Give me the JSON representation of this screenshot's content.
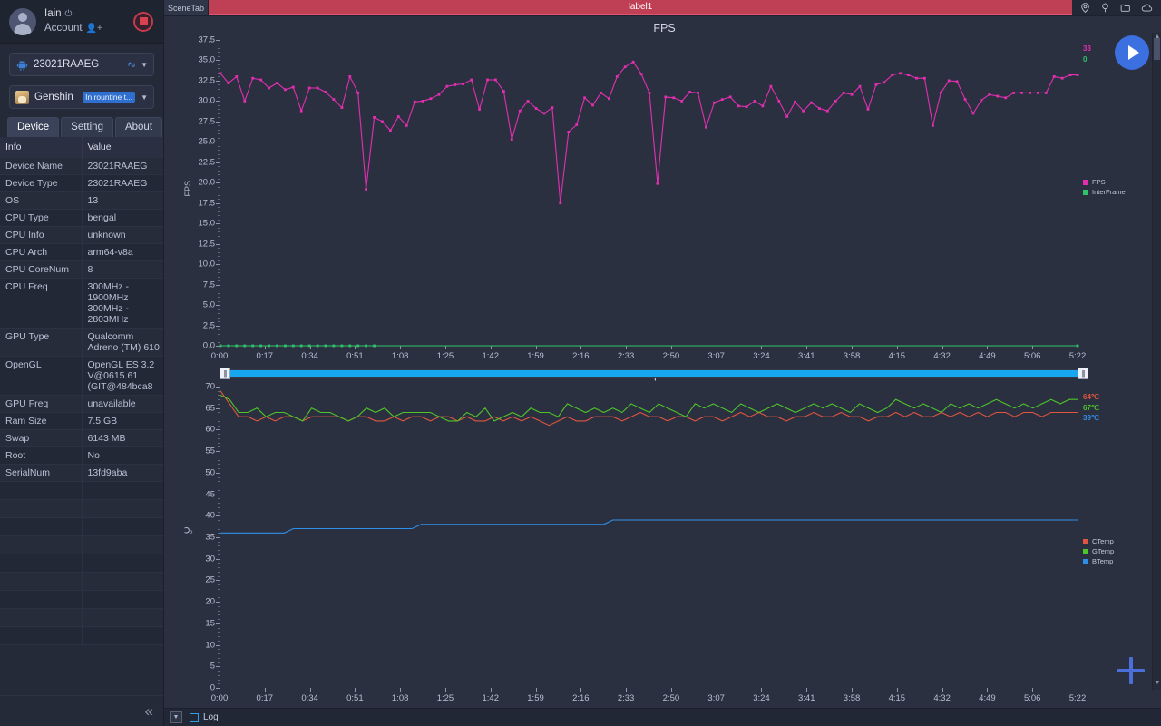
{
  "sidebar": {
    "account": {
      "name": "Iain",
      "power_icon": "power-icon",
      "label": "Account",
      "account_icon": "user-add-icon",
      "record_button": "record-button"
    },
    "device_selector": {
      "value": "23021RAAEG",
      "device_icon": "android-icon",
      "link_icon": "link-icon",
      "caret": "chevron-down-icon"
    },
    "app_selector": {
      "value": "Genshin Imp...",
      "tag": "In rountine t...",
      "app_icon": "app-thumbnail",
      "caret": "chevron-down-icon"
    },
    "tabs": [
      {
        "label": "Device",
        "active": true
      },
      {
        "label": "Setting",
        "active": false
      },
      {
        "label": "About",
        "active": false
      }
    ],
    "table": {
      "headers": [
        "Info",
        "Value"
      ],
      "rows": [
        [
          "Device Name",
          "23021RAAEG"
        ],
        [
          "Device Type",
          "23021RAAEG"
        ],
        [
          "OS",
          "13"
        ],
        [
          "CPU Type",
          "bengal"
        ],
        [
          "CPU Info",
          "unknown"
        ],
        [
          "CPU Arch",
          "arm64-v8a"
        ],
        [
          "CPU CoreNum",
          "8"
        ],
        [
          "CPU Freq",
          "300MHz - 1900MHz\n300MHz - 2803MHz"
        ],
        [
          "GPU Type",
          "Qualcomm Adreno (TM) 610"
        ],
        [
          "OpenGL",
          "OpenGL ES 3.2 V@0615.61 (GIT@484bca8"
        ],
        [
          "GPU Freq",
          "unavailable"
        ],
        [
          "Ram Size",
          "7.5 GB"
        ],
        [
          "Swap",
          "6143 MB"
        ],
        [
          "Root",
          "No"
        ],
        [
          "SerialNum",
          "13fd9aba"
        ]
      ]
    },
    "collapse_icon": "chevron-double-left-icon"
  },
  "topbar": {
    "scene_tab": "SceneTab",
    "label_tab": "label1",
    "icons": [
      "location-icon",
      "pin-icon",
      "folder-icon",
      "cloud-icon"
    ]
  },
  "buttons": {
    "play": "play-button",
    "add": "add-button"
  },
  "statusbar": {
    "dropdown_icon": "caret-down-button",
    "log_label": "Log",
    "log_checked": false
  },
  "chart_data": [
    {
      "type": "line",
      "title": "FPS",
      "xlabel": "",
      "ylabel": "FPS",
      "ylim": [
        0.0,
        37.5
      ],
      "yticks": [
        "0.0",
        "2.5",
        "5.0",
        "7.5",
        "10.0",
        "12.5",
        "15.0",
        "17.5",
        "20.0",
        "22.5",
        "25.0",
        "27.5",
        "30.0",
        "32.5",
        "35.0",
        "37.5"
      ],
      "xticks": [
        "0:00",
        "0:17",
        "0:34",
        "0:51",
        "1:08",
        "1:25",
        "1:42",
        "1:59",
        "2:16",
        "2:33",
        "2:50",
        "3:07",
        "3:24",
        "3:41",
        "3:58",
        "4:15",
        "4:32",
        "4:49",
        "5:06",
        "5:22"
      ],
      "grid": false,
      "legend_position": "right",
      "legend": [
        {
          "name": "FPS",
          "color": "#e12fb0"
        },
        {
          "name": "InterFrame",
          "color": "#2fc46a"
        }
      ],
      "current_values": [
        {
          "name": "FPS",
          "value": "33",
          "color": "#e12fb0"
        },
        {
          "name": "InterFrame",
          "value": "0",
          "color": "#2fc46a"
        }
      ],
      "series": [
        {
          "name": "FPS",
          "color": "#e12fb0",
          "values": [
            33.4,
            32.2,
            33.0,
            30.0,
            32.8,
            32.6,
            31.6,
            32.2,
            31.4,
            31.7,
            28.8,
            31.6,
            31.6,
            31.1,
            30.2,
            29.2,
            33.0,
            31.0,
            19.2,
            28.0,
            27.5,
            26.4,
            28.1,
            27.0,
            29.9,
            30.0,
            30.3,
            30.8,
            31.8,
            32.0,
            32.1,
            32.6,
            29.0,
            32.6,
            32.6,
            31.2,
            25.3,
            28.8,
            30.0,
            29.1,
            28.5,
            29.2,
            17.5,
            26.2,
            27.1,
            30.4,
            29.5,
            31.0,
            30.3,
            33.0,
            34.2,
            34.8,
            33.3,
            31.0,
            19.9,
            30.5,
            30.4,
            30.0,
            31.1,
            31.0,
            26.8,
            29.8,
            30.2,
            30.5,
            29.4,
            29.3,
            30.0,
            29.4,
            31.8,
            30.0,
            28.1,
            29.9,
            28.8,
            29.8,
            29.1,
            28.8,
            30.0,
            31.0,
            30.8,
            31.8,
            29.0,
            32.0,
            32.3,
            33.2,
            33.4,
            33.2,
            32.8,
            32.8,
            27.0,
            31.0,
            32.5,
            32.4,
            30.2,
            28.5,
            30.1,
            30.8,
            30.6,
            30.4,
            31.0,
            31.0,
            31.0,
            31.0,
            31.0,
            33.0,
            32.8,
            33.2
          ]
        },
        {
          "name": "InterFrame",
          "color": "#2fc46a",
          "values": [
            0,
            0,
            0,
            0,
            0,
            0,
            0,
            0,
            0,
            0,
            0,
            0,
            0,
            0,
            0,
            0,
            0,
            0,
            0,
            0
          ]
        }
      ]
    },
    {
      "type": "line",
      "title": "Temperature",
      "xlabel": "",
      "ylabel": "℃",
      "ylim": [
        0,
        70
      ],
      "yticks": [
        "0",
        "5",
        "10",
        "15",
        "20",
        "25",
        "30",
        "35",
        "40",
        "45",
        "50",
        "55",
        "60",
        "65",
        "70"
      ],
      "xticks": [
        "0:00",
        "0:17",
        "0:34",
        "0:51",
        "1:08",
        "1:25",
        "1:42",
        "1:59",
        "2:16",
        "2:33",
        "2:50",
        "3:07",
        "3:24",
        "3:41",
        "3:58",
        "4:15",
        "4:32",
        "4:49",
        "5:06",
        "5:22"
      ],
      "grid": false,
      "legend_position": "right",
      "legend": [
        {
          "name": "CTemp",
          "color": "#e0553f"
        },
        {
          "name": "GTemp",
          "color": "#4ec42a"
        },
        {
          "name": "BTemp",
          "color": "#2f8fe8"
        }
      ],
      "current_values": [
        {
          "name": "CTemp",
          "value": "64℃",
          "color": "#e0553f"
        },
        {
          "name": "GTemp",
          "value": "67℃",
          "color": "#4ec42a"
        },
        {
          "name": "BTemp",
          "value": "39℃",
          "color": "#2f8fe8"
        }
      ],
      "series": [
        {
          "name": "CTemp",
          "color": "#e0553f",
          "values": [
            69,
            66,
            63,
            63,
            62,
            63,
            62,
            63,
            63,
            62,
            63,
            63,
            63,
            63,
            62,
            63,
            63,
            62,
            62,
            63,
            62,
            63,
            63,
            62,
            63,
            63,
            62,
            63,
            62,
            62,
            63,
            62,
            63,
            62,
            63,
            62,
            61,
            62,
            63,
            62,
            62,
            63,
            63,
            63,
            62,
            63,
            64,
            63,
            63,
            62,
            63,
            63,
            62,
            63,
            63,
            62,
            63,
            64,
            63,
            64,
            63,
            63,
            62,
            63,
            63,
            64,
            63,
            63,
            64,
            63,
            63,
            62,
            63,
            63,
            64,
            63,
            64,
            63,
            63,
            64,
            63,
            64,
            63,
            64,
            63,
            64,
            64,
            63,
            64,
            64,
            63,
            64,
            64,
            64
          ]
        },
        {
          "name": "GTemp",
          "color": "#4ec42a",
          "values": [
            68,
            67,
            64,
            64,
            65,
            63,
            64,
            64,
            63,
            62,
            65,
            64,
            64,
            63,
            62,
            63,
            65,
            64,
            65,
            63,
            64,
            64,
            64,
            64,
            63,
            62,
            62,
            64,
            63,
            65,
            62,
            63,
            64,
            63,
            65,
            64,
            64,
            63,
            66,
            65,
            64,
            65,
            64,
            65,
            64,
            66,
            65,
            64,
            66,
            65,
            64,
            63,
            66,
            65,
            66,
            65,
            64,
            66,
            65,
            64,
            65,
            66,
            65,
            64,
            65,
            66,
            65,
            66,
            65,
            64,
            66,
            65,
            64,
            65,
            67,
            66,
            65,
            66,
            65,
            64,
            66,
            65,
            66,
            65,
            66,
            67,
            66,
            65,
            66,
            65,
            66,
            67,
            66,
            67
          ]
        },
        {
          "name": "BTemp",
          "color": "#2f8fe8",
          "values": [
            36,
            36,
            36,
            36,
            36,
            36,
            36,
            36,
            37,
            37,
            37,
            37,
            37,
            37,
            37,
            37,
            37,
            37,
            37,
            37,
            37,
            37,
            38,
            38,
            38,
            38,
            38,
            38,
            38,
            38,
            38,
            38,
            38,
            38,
            38,
            38,
            38,
            38,
            38,
            38,
            38,
            38,
            38,
            39,
            39,
            39,
            39,
            39,
            39,
            39,
            39,
            39,
            39,
            39,
            39,
            39,
            39,
            39,
            39,
            39,
            39,
            39,
            39,
            39,
            39,
            39,
            39,
            39,
            39,
            39,
            39,
            39,
            39,
            39,
            39,
            39,
            39,
            39,
            39,
            39,
            39,
            39,
            39,
            39,
            39,
            39,
            39,
            39,
            39,
            39,
            39,
            39,
            39,
            39
          ]
        }
      ]
    }
  ]
}
